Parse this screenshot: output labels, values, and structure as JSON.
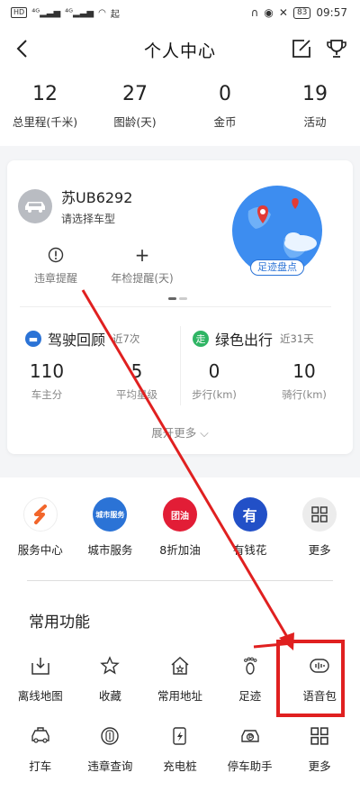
{
  "status_bar": {
    "left": "HD 4G 4G",
    "time": "09:57",
    "battery": "83"
  },
  "header": {
    "title": "个人中心"
  },
  "stats": [
    {
      "value": "12",
      "label": "总里程(千米)"
    },
    {
      "value": "27",
      "label": "图龄(天)"
    },
    {
      "value": "0",
      "label": "金币"
    },
    {
      "value": "19",
      "label": "活动"
    }
  ],
  "car": {
    "plate": "苏UB6292",
    "type_prompt": "请选择车型"
  },
  "reminders": [
    {
      "label": "违章提醒"
    },
    {
      "label": "年检提醒(天)"
    }
  ],
  "footprint_button": "足迹盘点",
  "driving": {
    "title": "驾驶回顾",
    "period": "近7次",
    "metrics": [
      {
        "value": "110",
        "label": "车主分"
      },
      {
        "value": "5",
        "label": "平均星级"
      }
    ]
  },
  "green": {
    "title": "绿色出行",
    "period": "近31天",
    "metrics": [
      {
        "value": "0",
        "label": "步行(km)"
      },
      {
        "value": "10",
        "label": "骑行(km)"
      }
    ]
  },
  "expand_label": "展开更多",
  "services": [
    {
      "label": "服务中心",
      "icon": "s"
    },
    {
      "label": "城市服务",
      "icon": "城市服务"
    },
    {
      "label": "8折加油",
      "icon": "团油"
    },
    {
      "label": "有钱花",
      "icon": "有"
    },
    {
      "label": "更多",
      "icon": "grid"
    }
  ],
  "common_title": "常用功能",
  "common_row1": [
    {
      "label": "离线地图"
    },
    {
      "label": "收藏"
    },
    {
      "label": "常用地址"
    },
    {
      "label": "足迹"
    },
    {
      "label": "语音包"
    }
  ],
  "common_row2": [
    {
      "label": "打车"
    },
    {
      "label": "违章查询"
    },
    {
      "label": "充电桩"
    },
    {
      "label": "停车助手"
    },
    {
      "label": "更多"
    }
  ],
  "colors": {
    "accent_blue": "#2b73d6",
    "green": "#2fb564",
    "annotation_red": "#e02020"
  }
}
